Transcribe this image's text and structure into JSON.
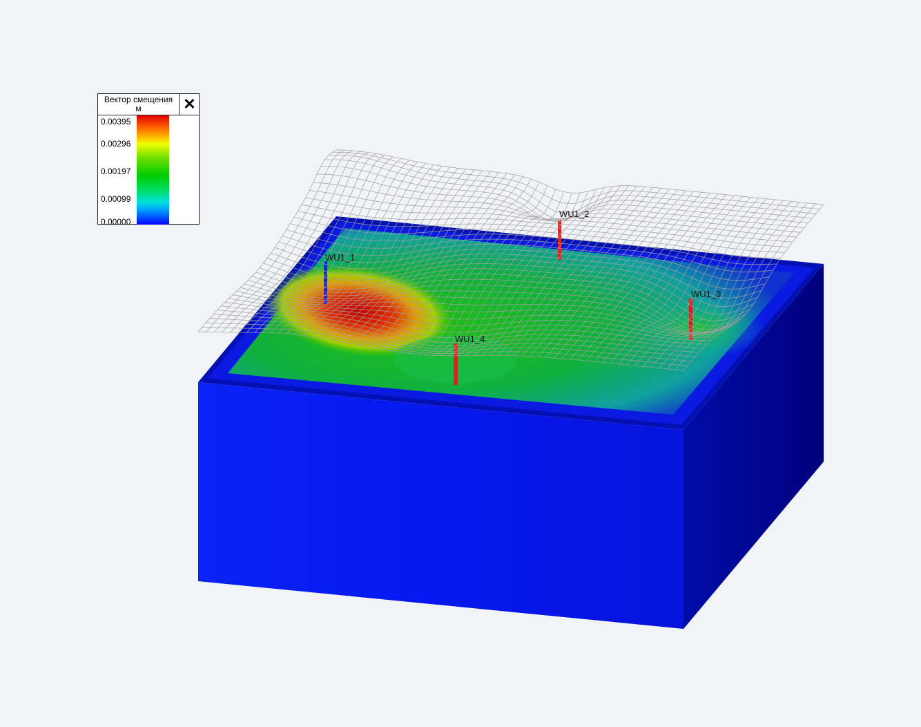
{
  "legend": {
    "title_line1": "Вектор смещения",
    "title_line2": "м",
    "close_icon": "close-icon",
    "ticks": [
      "0.00395",
      "0.00296",
      "0.00197",
      "0.00099",
      "0.00000"
    ],
    "colors": {
      "max": "#e00000",
      "high": "#ffd000",
      "mid": "#00cc00",
      "low": "#00e0e0",
      "min": "#0000ff"
    }
  },
  "wells": [
    {
      "name": "WU1_1",
      "color": "#1020ff"
    },
    {
      "name": "WU1_2",
      "color": "#e02020"
    },
    {
      "name": "WU1_3",
      "color": "#e02020"
    },
    {
      "name": "WU1_4",
      "color": "#e02020"
    }
  ],
  "model": {
    "block_front_color": "#0a1af0",
    "block_side_color": "#00008e",
    "mesh_color": "#a0a0a0"
  }
}
